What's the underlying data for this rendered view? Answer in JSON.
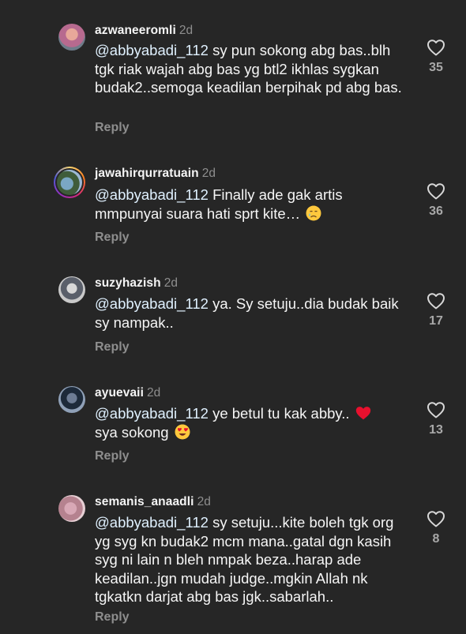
{
  "comments": [
    {
      "username": "azwaneeromli",
      "time": "2d",
      "mention": "@abbyabadi_112",
      "text": " sy pun sokong abg bas..blh tgk riak wajah abg bas yg btl2 ikhlas sygkan budak2..semoga keadilan berpihak pd abg bas.",
      "reply": "Reply",
      "likes": "35",
      "emoji": ""
    },
    {
      "username": "jawahirqurratuain",
      "time": "2d",
      "mention": "@abbyabadi_112",
      "text": " Finally ade gak artis mmpunyai suara hati sprt kite… ",
      "reply": "Reply",
      "likes": "36",
      "emoji": "crying-face-emoji"
    },
    {
      "username": "suzyhazish",
      "time": "2d",
      "mention": "@abbyabadi_112",
      "text": " ya. Sy setuju..dia budak baik sy nampak..",
      "reply": "Reply",
      "likes": "17",
      "emoji": ""
    },
    {
      "username": "ayuevaii",
      "time": "2d",
      "mention": "@abbyabadi_112",
      "text": " ye betul tu kak abby.. ",
      "text2": " sya sokong ",
      "reply": "Reply",
      "likes": "13",
      "emoji": "red-heart-emoji",
      "emoji2": "heart-eyes-emoji"
    },
    {
      "username": "semanis_anaadli",
      "time": "2d",
      "mention": "@abbyabadi_112",
      "text": " sy setuju...kite boleh tgk org yg syg kn budak2 mcm mana..gatal dgn kasih syg ni lain n bleh nmpak beza..harap ade keadilan..jgn mudah judge..mgkin Allah nk tgkatkn darjat abg bas jgk..sabarlah..",
      "reply": "Reply",
      "likes": "8",
      "emoji": ""
    }
  ],
  "icons": {
    "like": "heart-outline-icon"
  },
  "colors": {
    "background": "#262626",
    "text": "#f5f5f5",
    "muted": "#8e8e8e",
    "mention": "#e0f1ff"
  }
}
